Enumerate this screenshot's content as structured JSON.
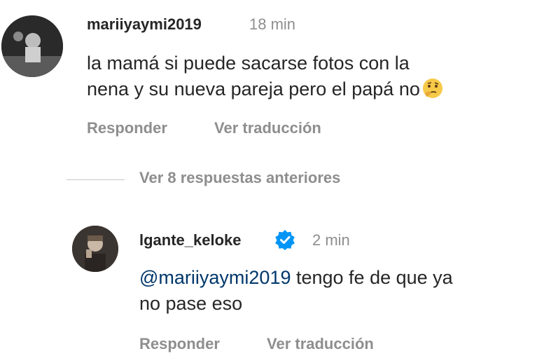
{
  "comment1": {
    "username": "mariiyaymi2019",
    "time": "18 min",
    "line1": "la mamá si puede sacarse fotos con la",
    "line2": "nena y su nueva pareja pero el papá no",
    "emoji": "thinking-face-icon",
    "reply_label": "Responder",
    "translate_label": "Ver traducción"
  },
  "view_replies": "Ver 8 respuestas anteriores",
  "reply": {
    "username": "lgante_keloke",
    "verified_icon": "verified-badge-icon",
    "time": "2 min",
    "mention": "@mariiyaymi2019",
    "line1_rest": " tengo fe de que ya",
    "line2": "no pase eso",
    "reply_label": "Responder",
    "translate_label": "Ver traducción"
  },
  "colors": {
    "text": "#262626",
    "secondary": "#8e8e8e",
    "mention": "#00376b",
    "verified": "#0095f6"
  }
}
